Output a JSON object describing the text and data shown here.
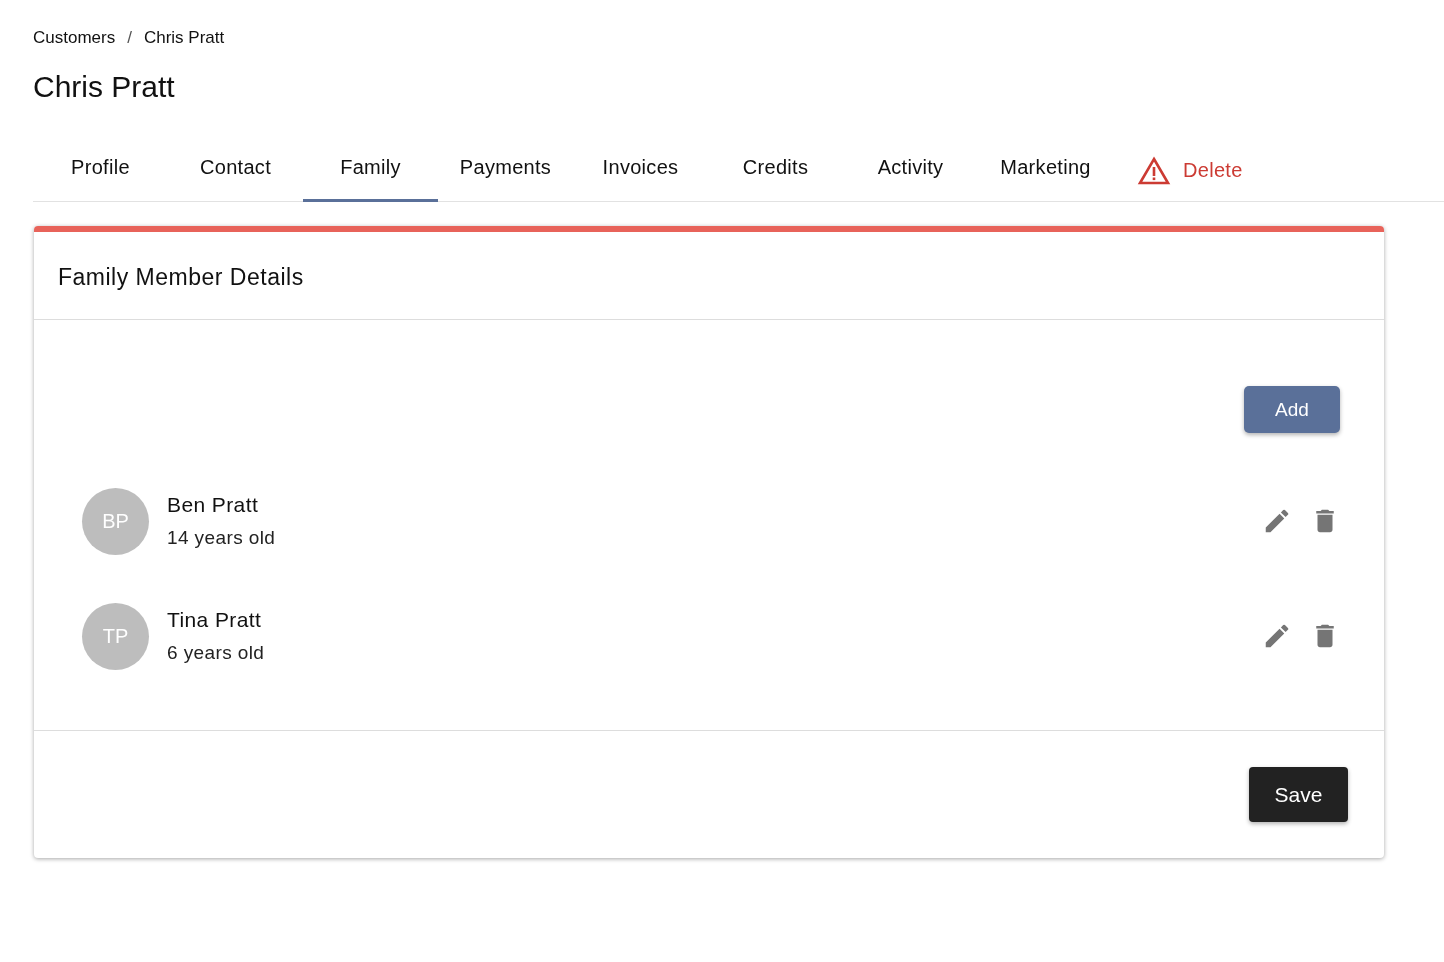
{
  "breadcrumbs": [
    "Customers",
    "Chris Pratt"
  ],
  "breadcrumb_separator": "/",
  "title": "Chris Pratt",
  "tabs": [
    {
      "label": "Profile",
      "kind": "normal",
      "selected": false
    },
    {
      "label": "Contact",
      "kind": "normal",
      "selected": false
    },
    {
      "label": "Family",
      "kind": "normal",
      "selected": true
    },
    {
      "label": "Payments",
      "kind": "normal",
      "selected": false
    },
    {
      "label": "Invoices",
      "kind": "normal",
      "selected": false
    },
    {
      "label": "Credits",
      "kind": "normal",
      "selected": false
    },
    {
      "label": "Activity",
      "kind": "normal",
      "selected": false
    },
    {
      "label": "Marketing",
      "kind": "normal",
      "selected": false
    },
    {
      "label": "Delete",
      "kind": "danger",
      "selected": false
    }
  ],
  "card": {
    "title": "Family Member Details",
    "add_button": "Add",
    "save_button": "Save",
    "members": [
      {
        "initials": "BP",
        "name": "Ben Pratt",
        "age": "14 years old"
      },
      {
        "initials": "TP",
        "name": "Tina Pratt",
        "age": "6 years old"
      }
    ]
  }
}
